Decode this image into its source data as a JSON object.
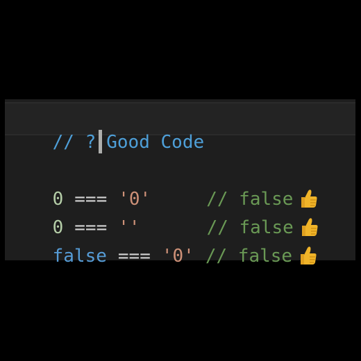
{
  "editor": {
    "header": {
      "comment_prefix": "// ?",
      "title": "Good Code"
    },
    "lines": [
      {
        "left": "0",
        "op": "===",
        "right": "'0'",
        "comment": "// false",
        "icon": "thumbs-up-icon"
      },
      {
        "left": "0",
        "op": "===",
        "right": "''",
        "comment": "// false",
        "icon": "thumbs-up-icon"
      },
      {
        "left": "false",
        "op": "===",
        "right": "'0'",
        "comment": "// false",
        "icon": "thumbs-up-icon"
      }
    ]
  },
  "colors": {
    "background": "#1e1e1e",
    "comment": "#6a9955",
    "header": "#4e9fd8",
    "number": "#b5cea8",
    "string": "#ce9178",
    "keyword": "#569cd6",
    "thumb": "#f0b429"
  }
}
